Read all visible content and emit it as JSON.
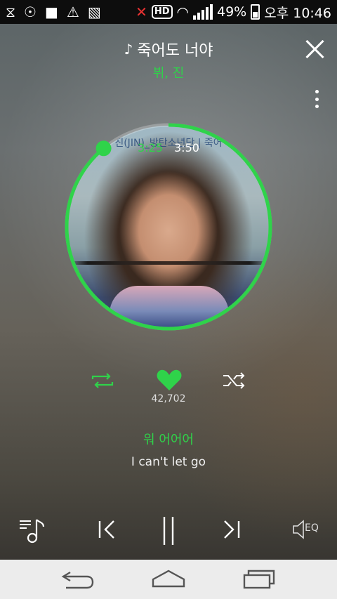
{
  "status_bar": {
    "battery": "49%",
    "time": "오후 10:46",
    "hd_badge": "HD"
  },
  "header": {
    "song_title": "죽어도 너야",
    "artist": "뷔, 진"
  },
  "player": {
    "elapsed_time": "3:25",
    "total_time": "3:50",
    "progress_fraction": 0.89,
    "album_overlay_text": "진(JIN)_방탄소년단 | 죽어",
    "like_count": "42,702"
  },
  "lyrics": {
    "current": "워 어어어",
    "next": "I can't let go"
  },
  "colors": {
    "accent": "#2fd34a",
    "nav_bg": "#ececec",
    "status_bg": "#0d0d0d"
  },
  "icons": {
    "playlist": "playlist-icon",
    "previous": "previous-icon",
    "pause": "pause-icon",
    "next": "next-icon",
    "eq": "eq-icon",
    "repeat": "repeat-icon",
    "heart": "heart-icon",
    "shuffle": "shuffle-icon"
  },
  "eq_label": "EQ"
}
